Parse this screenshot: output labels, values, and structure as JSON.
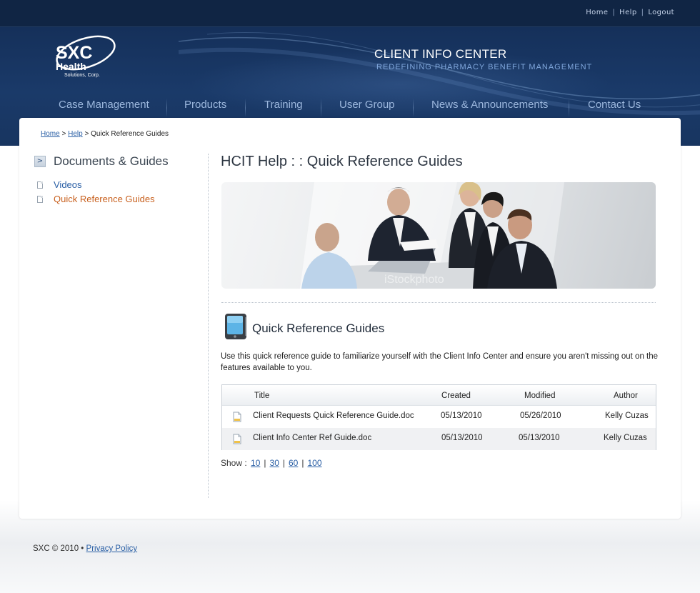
{
  "top_links": [
    "Home",
    "Help",
    "Logout"
  ],
  "logo": {
    "line1": "SXC",
    "line2": "Health",
    "line3": "Solutions, Corp."
  },
  "header": {
    "title": "CLIENT INFO CENTER",
    "tagline": "REDEFINING PHARMACY BENEFIT MANAGEMENT"
  },
  "nav": [
    "Case Management",
    "Products",
    "Training",
    "User Group",
    "News & Announcements",
    "Contact Us"
  ],
  "breadcrumb": {
    "home": "Home",
    "help": "Help",
    "current": "Quick Reference Guides",
    "sep": ">"
  },
  "sidebar": {
    "title": "Documents & Guides",
    "items": [
      "Videos",
      "Quick Reference Guides"
    ]
  },
  "page": {
    "title": "HCIT Help : : Quick Reference Guides",
    "hero_watermark": "iStockphoto",
    "section_title": "Quick Reference Guides",
    "intro": "Use this quick reference guide to familiarize yourself with the Client Info Center and ensure you aren't missing out on the features available to you."
  },
  "table": {
    "headers": {
      "title": "Title",
      "created": "Created",
      "modified": "Modified",
      "author": "Author"
    },
    "rows": [
      {
        "title": "Client Requests Quick Reference Guide.doc",
        "created": "05/13/2010",
        "modified": "05/26/2010",
        "author": "Kelly Cuzas"
      },
      {
        "title": "Client Info Center Ref Guide.doc",
        "created": "05/13/2010",
        "modified": "05/13/2010",
        "author": "Kelly Cuzas"
      }
    ]
  },
  "pager": {
    "label": "Show :",
    "options": [
      "10",
      "30",
      "60",
      "100"
    ]
  },
  "footer": {
    "copyright": "SXC © 2010 •",
    "privacy": "Privacy Policy"
  },
  "colors": {
    "header_bg": "#1a3a69",
    "nav_text": "#9cb7dd",
    "link": "#2a5fa5",
    "active_link": "#c8601e"
  }
}
